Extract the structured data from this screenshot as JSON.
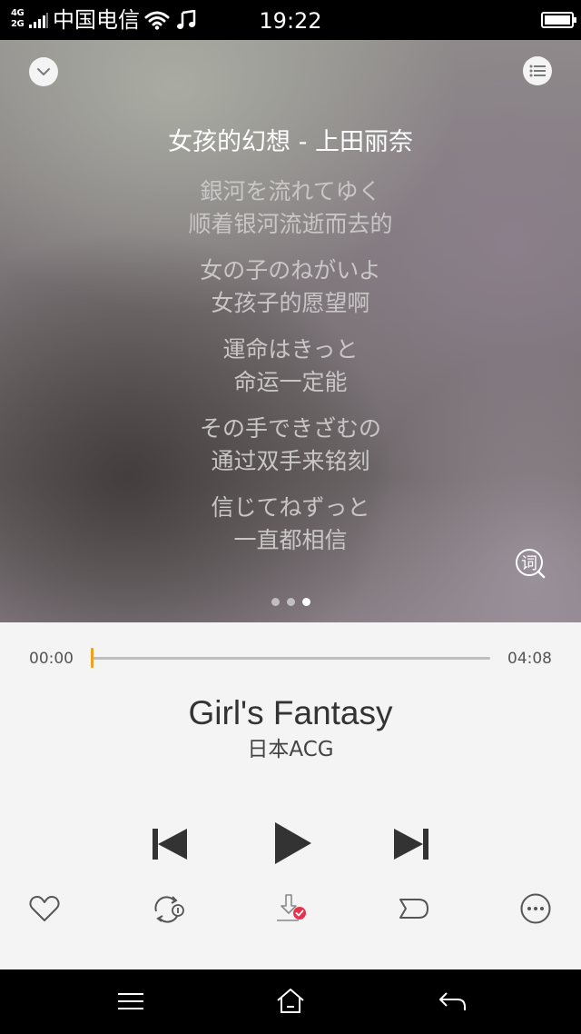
{
  "status_bar": {
    "network_top": "4G",
    "network_bottom": "2G",
    "carrier": "中国电信",
    "time": "19:22",
    "icons": [
      "signal-icon",
      "wifi-icon",
      "music-note-icon",
      "battery-icon"
    ]
  },
  "lyrics_panel": {
    "song_header": "女孩的幻想 - 上田丽奈",
    "lines": [
      "銀河を流れてゆく",
      "顺着银河流逝而去的",
      "女の子のねがいよ",
      "女孩子的愿望啊",
      "運命はきっと",
      "命运一定能",
      "その手できざむの",
      "通过双手来铭刻",
      "信じてねずっと",
      "一直都相信"
    ],
    "lyric_button_label": "词",
    "page_count": 3,
    "active_page": 3,
    "icons": [
      "chevron-down-icon",
      "playlist-icon",
      "lyric-search-icon"
    ]
  },
  "player": {
    "current_time": "00:00",
    "total_time": "04:08",
    "progress_fraction": 0.0,
    "title": "Girl's Fantasy",
    "artist": "日本ACG",
    "accent_color": "#f0a020",
    "download_badge_color": "#e8304f",
    "icons": [
      "previous-icon",
      "play-icon",
      "next-icon",
      "heart-icon",
      "repeat-one-icon",
      "download-icon",
      "tag-icon",
      "more-icon"
    ]
  },
  "nav_bar": {
    "icons": [
      "menu-icon",
      "home-icon",
      "back-icon"
    ]
  }
}
